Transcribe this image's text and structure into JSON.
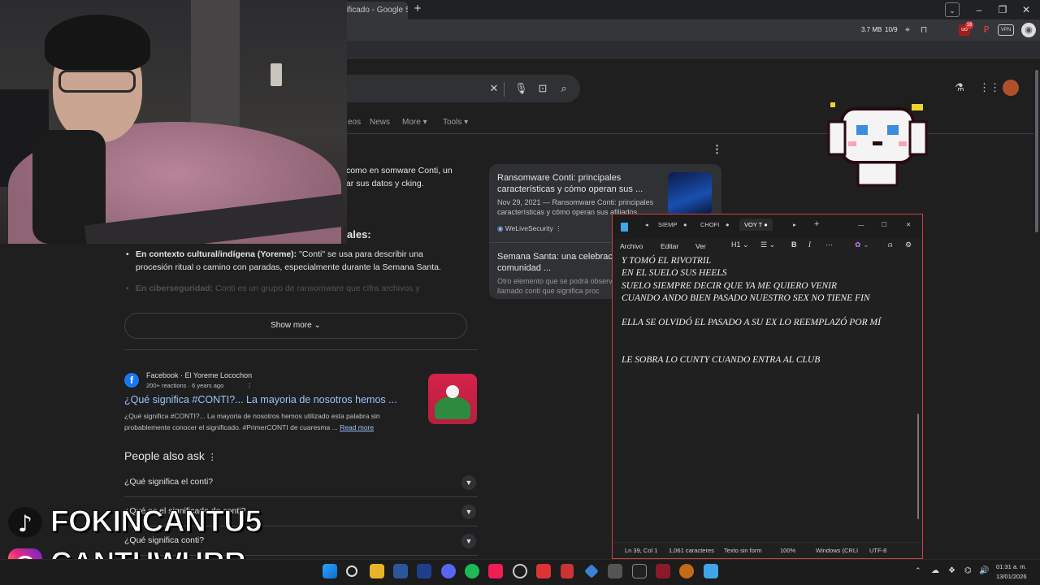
{
  "browser": {
    "tab_title": "ificado - Google S",
    "toolbar": {
      "memory": "3.7 MB",
      "counter": "10/9",
      "vpn": "VPN"
    }
  },
  "google": {
    "nav_tabs": [
      "eos",
      "News",
      "More",
      "Tools"
    ],
    "ai_overview_text": "ca procesión (como en somware Conti, un iones para cifrar sus datos y cking.",
    "section_heading": "ales:",
    "bullets": [
      {
        "label": "En contexto cultural/indígena (Yoreme):",
        "text": "\"Conti\" se usa para describir una procesión ritual o camino con paradas, especialmente durante la Semana Santa."
      },
      {
        "label": "En ciberseguridad:",
        "text": "Conti es un grupo de ransomware que cifra archivos y"
      }
    ],
    "show_more": "Show more",
    "side_card": {
      "title1": "Ransomware Conti: principales características y cómo operan sus ...",
      "meta1": "Nov 29, 2021 — Ransomware Conti: principales características y cómo operan sus afiliados.",
      "source1": "WeLiveSecurity",
      "title2": "Semana Santa: una celebración en la comunidad ...",
      "meta2": "Otro elemento que se podrá observar es el llamado conti que significa proc"
    },
    "result": {
      "source": "Facebook · El Yoreme Locochon",
      "meta": "200+ reactions · 6 years ago",
      "title": "¿Qué significa #CONTI?... La mayoria de nosotros hemos ...",
      "snippet": "¿Qué significa #CONTI?... La mayoria de nosotros hemos utilizado esta palabra sin probablemente conocer el significado. #PrimerCONTI de cuaresma ...",
      "read_more": "Read more"
    },
    "people_also_ask": {
      "title": "People also ask",
      "questions": [
        "¿Qué significa el conti?",
        "¿Qué es el significado de conti?",
        "¿Qué significa conti?"
      ]
    }
  },
  "notepad": {
    "tabs": [
      "SIEMP",
      "CHOFI",
      "VOY T"
    ],
    "menu": [
      "Archivo",
      "Editar",
      "Ver"
    ],
    "heading_select": "H1",
    "lines": "Y TOMÓ EL RIVOTRIL\nEN EL SUELO SUS HEELS\nSUELO SIEMPRE DECIR QUE YA ME QUIERO VENIR\nCUANDO ANDO BIEN PASADO NUESTRO SEX NO TIENE FIN\n\nELLA SE OLVIDÓ EL PASADO A SU EX LO REEMPLAZÓ POR MÍ\n\n\nLE SOBRA LO CUNTY CUANDO ENTRA AL CLUB",
    "status": {
      "position": "Ln 39, Col 1",
      "chars": "1,061 caracteres",
      "format": "Texto sin form",
      "zoom": "100%",
      "eol": "Windows (CRLI",
      "encoding": "UTF-8"
    }
  },
  "overlays": {
    "tiktok": "FOKINCANTU5",
    "instagram": "CANTUWURR"
  },
  "taskbar": {
    "time": "01:31 a. m.",
    "date": "13/01/2026",
    "badge": "18"
  },
  "colors": {
    "accent_red": "#d04040",
    "link": "#99c3ff",
    "facebook": "#1877f2"
  }
}
